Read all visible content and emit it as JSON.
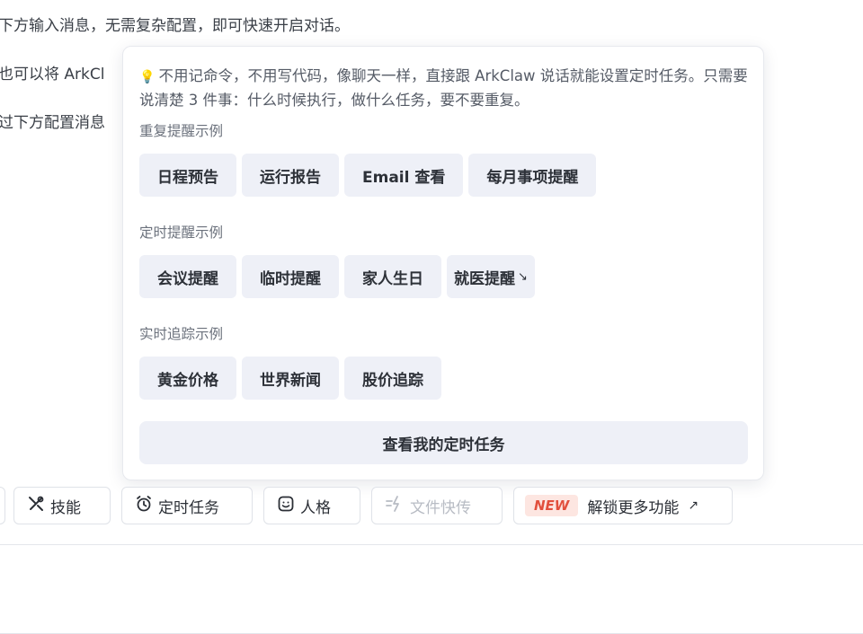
{
  "background": {
    "line1": "下方输入消息，无需复杂配置，即可快速开启对话。",
    "line2": "也可以将 ArkCl",
    "line3": "过下方配置消息"
  },
  "popover": {
    "tip_icon": "lightbulb-icon",
    "tip_text": "不用记命令，不用写代码，像聊天一样，直接跟 ArkClaw 说话就能设置定时任务。只需要说清楚 3 件事：什么时候执行，做什么任务，要不要重复。",
    "sections": [
      {
        "title": "重复提醒示例",
        "chips": [
          "日程预告",
          "运行报告",
          "Email 查看",
          "每月事项提醒"
        ]
      },
      {
        "title": "定时提醒示例",
        "chips": [
          "会议提醒",
          "临时提醒",
          "家人生日",
          "就医提醒"
        ]
      },
      {
        "title": "实时追踪示例",
        "chips": [
          "黄金价格",
          "世界新闻",
          "股价追踪"
        ]
      }
    ],
    "view_button": "查看我的定时任务"
  },
  "toolbar": {
    "skills": {
      "label": "技能",
      "icon": "tools-icon"
    },
    "scheduled": {
      "label": "定时任务",
      "icon": "alarm-clock-icon"
    },
    "persona": {
      "label": "人格",
      "icon": "smiley-icon"
    },
    "file_transfer": {
      "label": "文件快传",
      "icon": "lightning-transfer-icon"
    },
    "unlock": {
      "badge": "NEW",
      "label": "解锁更多功能",
      "icon": "external-arrow-icon"
    }
  },
  "colors": {
    "chip_bg": "#eef0f7",
    "badge_bg": "#fde6e1",
    "badge_text": "#e2503d",
    "bulb": "#f3b33d"
  }
}
